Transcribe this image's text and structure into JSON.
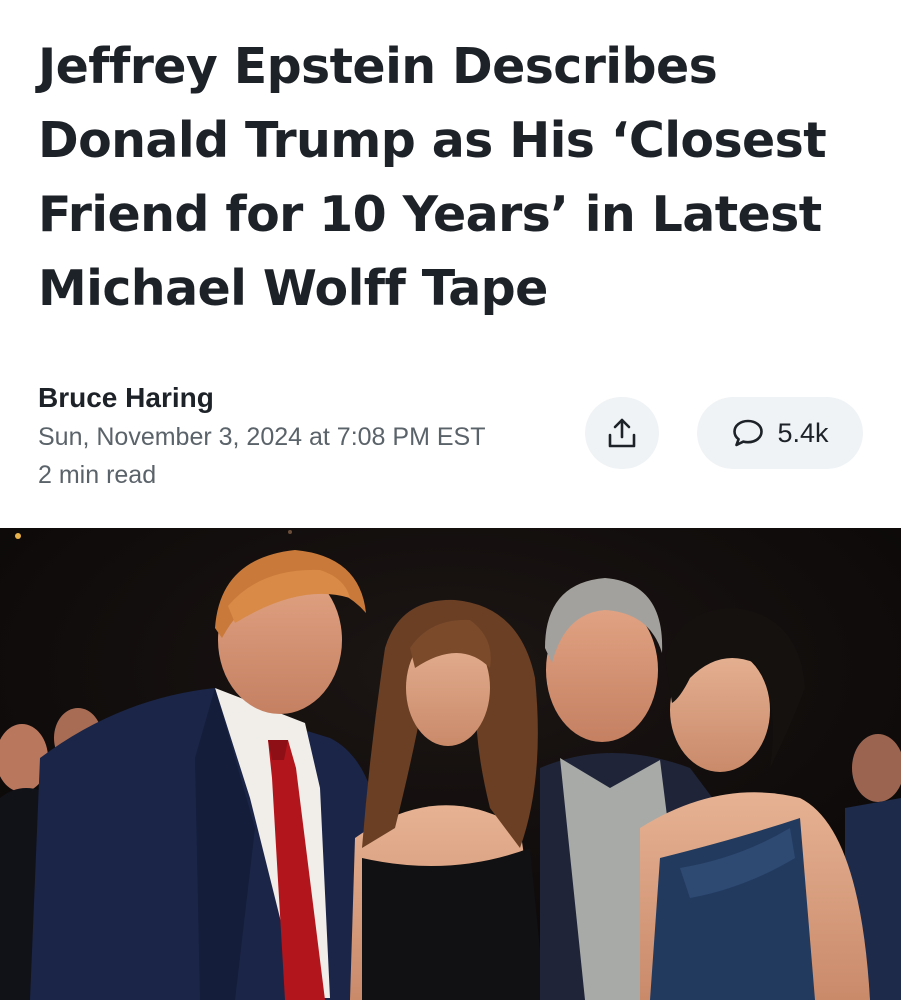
{
  "article": {
    "headline": "Jeffrey Epstein Describes Donald Trump as His ‘Closest Friend for 10 Years’ in Latest Michael Wolff Tape",
    "author": "Bruce Haring",
    "timestamp": "Sun, November 3, 2024 at 7:08 PM EST",
    "read_time": "2 min read"
  },
  "actions": {
    "share_icon": "share-icon",
    "comment_icon": "comment-bubble-icon",
    "comment_count": "5.4k"
  },
  "photo": {
    "description_icon": "photo"
  },
  "colors": {
    "text_primary": "#1d2228",
    "text_secondary": "#5b636a",
    "button_bg": "#f0f3f5",
    "photo_bg": "#0a0808"
  }
}
